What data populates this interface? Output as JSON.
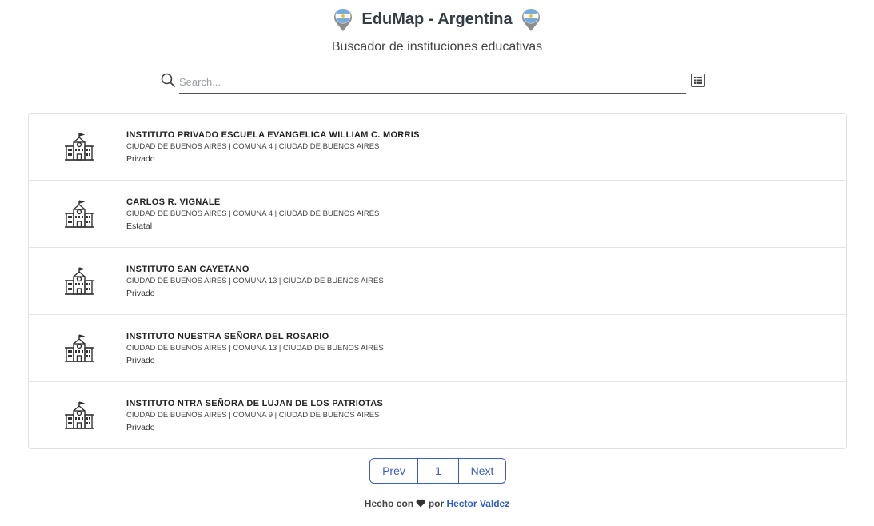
{
  "header": {
    "title": "EduMap - Argentina",
    "subtitle": "Buscador de instituciones educativas"
  },
  "search": {
    "placeholder": "Search...",
    "value": ""
  },
  "results": [
    {
      "name": "INSTITUTO PRIVADO ESCUELA EVANGELICA WILLIAM C. MORRIS",
      "location": "CIUDAD DE BUENOS AIRES | COMUNA 4 | CIUDAD DE BUENOS AIRES",
      "type": "Privado"
    },
    {
      "name": "CARLOS R. VIGNALE",
      "location": "CIUDAD DE BUENOS AIRES | COMUNA 4 | CIUDAD DE BUENOS AIRES",
      "type": "Estatal"
    },
    {
      "name": "INSTITUTO SAN CAYETANO",
      "location": "CIUDAD DE BUENOS AIRES | COMUNA 13 | CIUDAD DE BUENOS AIRES",
      "type": "Privado"
    },
    {
      "name": "INSTITUTO NUESTRA SEÑORA DEL ROSARIO",
      "location": "CIUDAD DE BUENOS AIRES | COMUNA 13 | CIUDAD DE BUENOS AIRES",
      "type": "Privado"
    },
    {
      "name": "INSTITUTO NTRA SEÑORA DE LUJAN DE LOS PATRIOTAS",
      "location": "CIUDAD DE BUENOS AIRES | COMUNA 9 | CIUDAD DE BUENOS AIRES",
      "type": "Privado"
    }
  ],
  "pagination": {
    "prev_label": "Prev",
    "current_page": "1",
    "next_label": "Next"
  },
  "footer": {
    "made_with": "Hecho con",
    "by": "por",
    "author": "Hector Valdez"
  },
  "colors": {
    "accent": "#3b5fc0",
    "flag_blue": "#74acdf",
    "flag_sun": "#f6b40e"
  },
  "icons": {
    "header_pins": "argentina-flag-pin-icon",
    "search": "search-icon",
    "toggle": "list-view-icon",
    "result": "school-building-icon",
    "footer": "heart-icon"
  }
}
